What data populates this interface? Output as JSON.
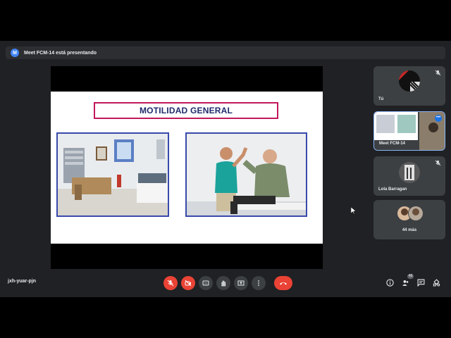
{
  "banner": {
    "avatar_letter": "M",
    "text": "Meet FCM-14 está presentando"
  },
  "slide": {
    "title": "MOTILIDAD GENERAL"
  },
  "participants": [
    {
      "name": "Tú"
    },
    {
      "name": "Meet FCM-14"
    },
    {
      "name": "Lola Barragan"
    },
    {
      "name": "44 más"
    }
  ],
  "footer": {
    "meeting_code": "jxh-yuar-pjn",
    "people_count": "48",
    "icons": [
      "mic-off-icon",
      "camera-off-icon",
      "captions-icon",
      "raise-hand-icon",
      "present-icon",
      "more-options-icon",
      "end-call-icon",
      "info-icon",
      "people-icon",
      "chat-icon",
      "activities-icon"
    ]
  },
  "colors": {
    "accent": "#1a73e8",
    "danger": "#ea4335",
    "slide_title": "#1f2a6b",
    "slide_border": "#c2185b"
  }
}
